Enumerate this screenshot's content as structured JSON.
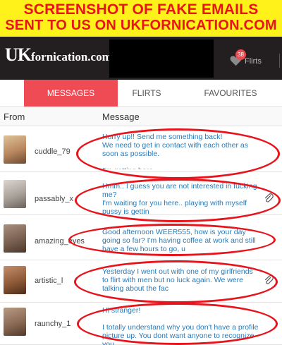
{
  "banner": {
    "line1": "SCREENSHOT OF FAKE EMAILS",
    "line2": "SENT TO US ON UKFORNICATION.COM"
  },
  "header": {
    "logo_uk": "UK",
    "logo_rest": "fornication.com",
    "flirts_count": "38",
    "flirts_label": "Flirts"
  },
  "tabs": [
    {
      "label": "MESSAGES",
      "active": true
    },
    {
      "label": "FLIRTS",
      "active": false
    },
    {
      "label": "FAVOURITES",
      "active": false
    }
  ],
  "list": {
    "col_from": "From",
    "col_message": "Message",
    "rows": [
      {
        "username": "cuddle_79",
        "message": "Hurry up!! Send me something back!\nWe need to get in contact with each other as soon as possible.\n\nI'm getting bore",
        "has_attachment": false,
        "avatar_color": "#c9a27a"
      },
      {
        "username": "passably_x",
        "message": "Hmm.. I guess you are not interested in fucking me?\nI'm waiting for you here.. playing with myself pussy is gettin",
        "has_attachment": true,
        "avatar_color": "#b9b3ad"
      },
      {
        "username": "amazing_eyes",
        "message": "Good afternoon WEER555, how is your day going so far? I'm having coffee at work and still have a few hours to go, u",
        "has_attachment": false,
        "avatar_color": "#8c7260"
      },
      {
        "username": "artistic_l",
        "message": "Yesterday I went out with one of my girlfriends to flirt with men but no luck again. We were talking about the fac",
        "has_attachment": true,
        "avatar_color": "#a0704e"
      },
      {
        "username": "raunchy_1",
        "message": "Hi stranger!\n\nI totally understand why you don't have a profile picture up. You dont want anyone to recognize you",
        "has_attachment": false,
        "avatar_color": "#9b7b64"
      }
    ]
  },
  "colors": {
    "banner_bg": "#fef21a",
    "banner_text": "#e8141c",
    "topbar_bg": "#231f20",
    "tab_active": "#ef4b54",
    "message_text": "#2a7ab6",
    "annotation": "#e8141c"
  },
  "icons": {
    "flirts": "heart-icon",
    "attachment": "paperclip-icon"
  }
}
